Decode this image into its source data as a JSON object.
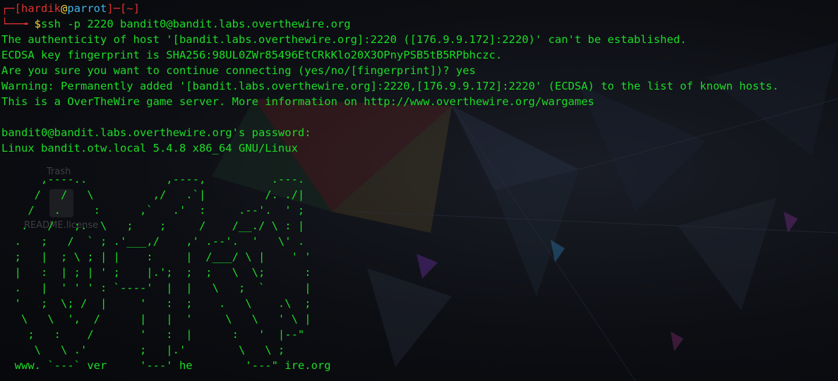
{
  "prompt": {
    "corner_top": "┌─",
    "open_bracket": "[",
    "user": "hardik",
    "at": "@",
    "host": "parrot",
    "close_bracket": "]",
    "dash": "─",
    "cwd_open": "[",
    "cwd": "~",
    "cwd_close": "]",
    "corner_bottom": "└──╼ ",
    "dollar": "$",
    "command": "ssh -p 2220 bandit0@bandit.labs.overthewire.org"
  },
  "output_lines": [
    "The authenticity of host '[bandit.labs.overthewire.org]:2220 ([176.9.9.172]:2220)' can't be established.",
    "ECDSA key fingerprint is SHA256:98UL0ZWr85496EtCRkKlo20X3OPnyPSB5tB5RPbhczc.",
    "Are you sure you want to continue connecting (yes/no/[fingerprint])? yes",
    "Warning: Permanently added '[bandit.labs.overthewire.org]:2220,[176.9.9.172]:2220' (ECDSA) to the list of known hosts.",
    "This is a OverTheWire game server. More information on http://www.overthewire.org/wargames",
    "",
    "bandit0@bandit.labs.overthewire.org's password:",
    "Linux bandit.otw.local 5.4.8 x86_64 GNU/Linux"
  ],
  "banner_ascii": "      ,----..            ,----,          .---.\n     /   /   \\         ,/   .`|         /. ./|\n    /   .     :      ,`   .'  :     .--'.  ' ;\n   .   /   ;.  \\   ;    ;     /    /__./ \\ : |\n  .   ;   /  ` ; .'___,/    ,' .--'.  '   \\' .\n  ;   |  ; \\ ; | |    :     |  /___/ \\ |    ' '\n  |   :  | ; | ' ;    |.';  ;  ;   \\  \\;      :\n  .   |  ' ' ' : `----'  |  |   \\   ;  `      |\n  '   ;  \\; /  |     '   :  ;    .   \\    .\\  ;\n   \\   \\  ',  /      |   |  '     \\   \\   ' \\ |\n    ;   :    /       '   :  |      :   '  |--\"\n     \\   \\ .'        ;   |.'        \\   \\ ;\n  www. `---` ver     '---' he        '---\" ire.org",
  "desktop": {
    "trash_label": "Trash",
    "readme_label": "README.license"
  },
  "colors": {
    "terminal_text": "#1ddc26",
    "prompt_red": "#e0322f",
    "prompt_blue": "#3fb4e6",
    "prompt_yellow": "#f0d23a",
    "background": "#0b0d12"
  }
}
